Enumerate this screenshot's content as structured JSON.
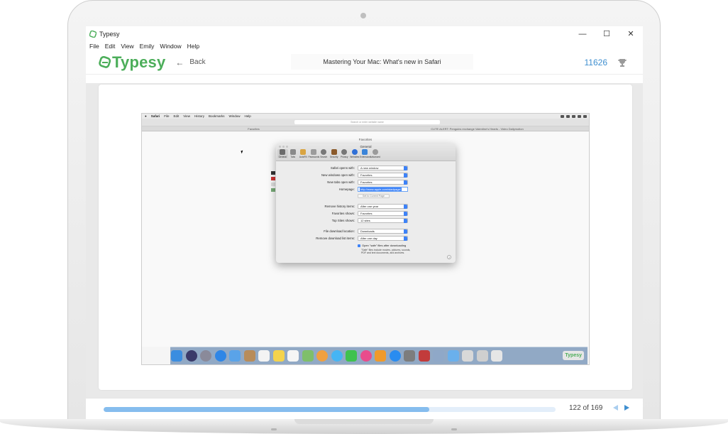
{
  "window": {
    "title": "Typesy",
    "minimize": "—",
    "maximize": "☐",
    "close": "✕"
  },
  "menu": [
    "File",
    "Edit",
    "View",
    "Emily",
    "Window",
    "Help"
  ],
  "header": {
    "brand": "Typesy",
    "back_label": "Back",
    "lesson_title": "Mastering Your Mac: What's new in Safari",
    "score": "11626",
    "brand_color": "#4cae5a",
    "accent_color": "#3f8fd0"
  },
  "mac_screenshot": {
    "menubar": [
      "Safari",
      "File",
      "Edit",
      "View",
      "History",
      "Bookmarks",
      "Window",
      "Help"
    ],
    "address_placeholder": "Search or enter website name",
    "tabs": [
      "Favorites",
      "CUTE ALERT: Penguins exchange Valentine's Hearts - Video Dailymotion"
    ],
    "favorites_label": "Favorites",
    "prefs": {
      "title": "General",
      "tabs": [
        "General",
        "Tabs",
        "AutoFill",
        "Passwords",
        "Search",
        "Security",
        "Privacy",
        "Websites",
        "Extensions",
        "Advanced"
      ],
      "rows": [
        {
          "label": "Safari opens with:",
          "value": "A new window"
        },
        {
          "label": "New windows open with:",
          "value": "Favorites"
        },
        {
          "label": "New tabs open with:",
          "value": "Favorites"
        }
      ],
      "homepage_label": "Homepage:",
      "homepage_value": "http://www.apple.com/startpage/",
      "set_current": "Set to Current Page",
      "rows2": [
        {
          "label": "Remove history items:",
          "value": "After one year"
        },
        {
          "label": "Favorites shows:",
          "value": "Favorites"
        },
        {
          "label": "Top Sites shows:",
          "value": "12 sites"
        }
      ],
      "rows3": [
        {
          "label": "File download location:",
          "value": "Downloads"
        },
        {
          "label": "Remove download list items:",
          "value": "After one day"
        }
      ],
      "open_safe": "Open \"safe\" files after downloading",
      "safe_note": "\"Safe\" files include movies, pictures, sounds, PDF and text documents, and archives.",
      "help": "?"
    },
    "dock_typesy": "Typesy"
  },
  "footer": {
    "page_count": "122 of 169",
    "progress": 0.72
  }
}
